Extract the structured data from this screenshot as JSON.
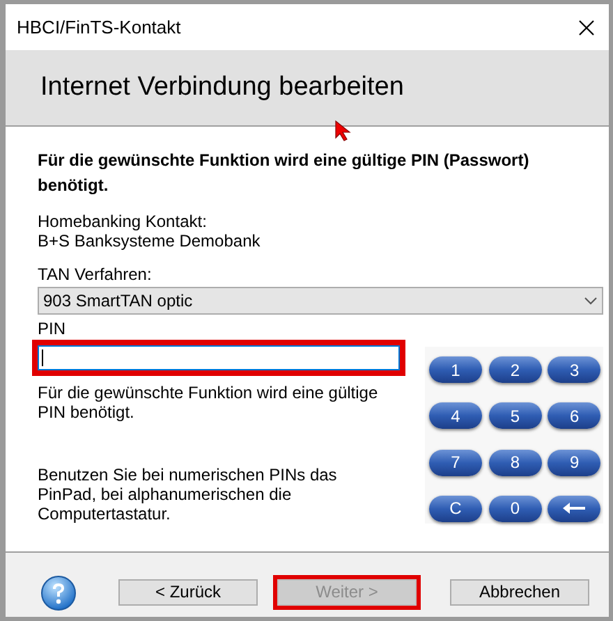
{
  "window": {
    "title": "HBCI/FinTS-Kontakt"
  },
  "header": {
    "title": "Internet Verbindung bearbeiten"
  },
  "message": "Für die gewünschte Funktion wird eine gültige PIN (Passwort) benötigt.",
  "contact": {
    "label": "Homebanking Kontakt:",
    "value": "B+S Banksysteme Demobank"
  },
  "tan": {
    "label": "TAN Verfahren:",
    "value": "903 SmartTAN optic"
  },
  "pin": {
    "label": "PIN",
    "highlighted": true,
    "focused": true
  },
  "pin_help": "Für die gewünschte Funktion wird eine gültige PIN benötigt.",
  "hint": "Benutzen Sie bei numerischen PINs das PinPad, bei alphanumerischen die Computertastatur.",
  "pinpad": [
    {
      "kind": "text",
      "label": "1"
    },
    {
      "kind": "text",
      "label": "2"
    },
    {
      "kind": "text",
      "label": "3"
    },
    {
      "kind": "text",
      "label": "4"
    },
    {
      "kind": "text",
      "label": "5"
    },
    {
      "kind": "text",
      "label": "6"
    },
    {
      "kind": "text",
      "label": "7"
    },
    {
      "kind": "text",
      "label": "8"
    },
    {
      "kind": "text",
      "label": "9"
    },
    {
      "kind": "text",
      "label": "C"
    },
    {
      "kind": "text",
      "label": "0"
    },
    {
      "kind": "backspace"
    }
  ],
  "buttons": [
    {
      "label": "< Zurück",
      "disabled": false,
      "highlighted": false
    },
    {
      "label": "Weiter >",
      "disabled": true,
      "highlighted": true
    },
    {
      "label": "Abbrechen",
      "disabled": false,
      "highlighted": false
    }
  ]
}
